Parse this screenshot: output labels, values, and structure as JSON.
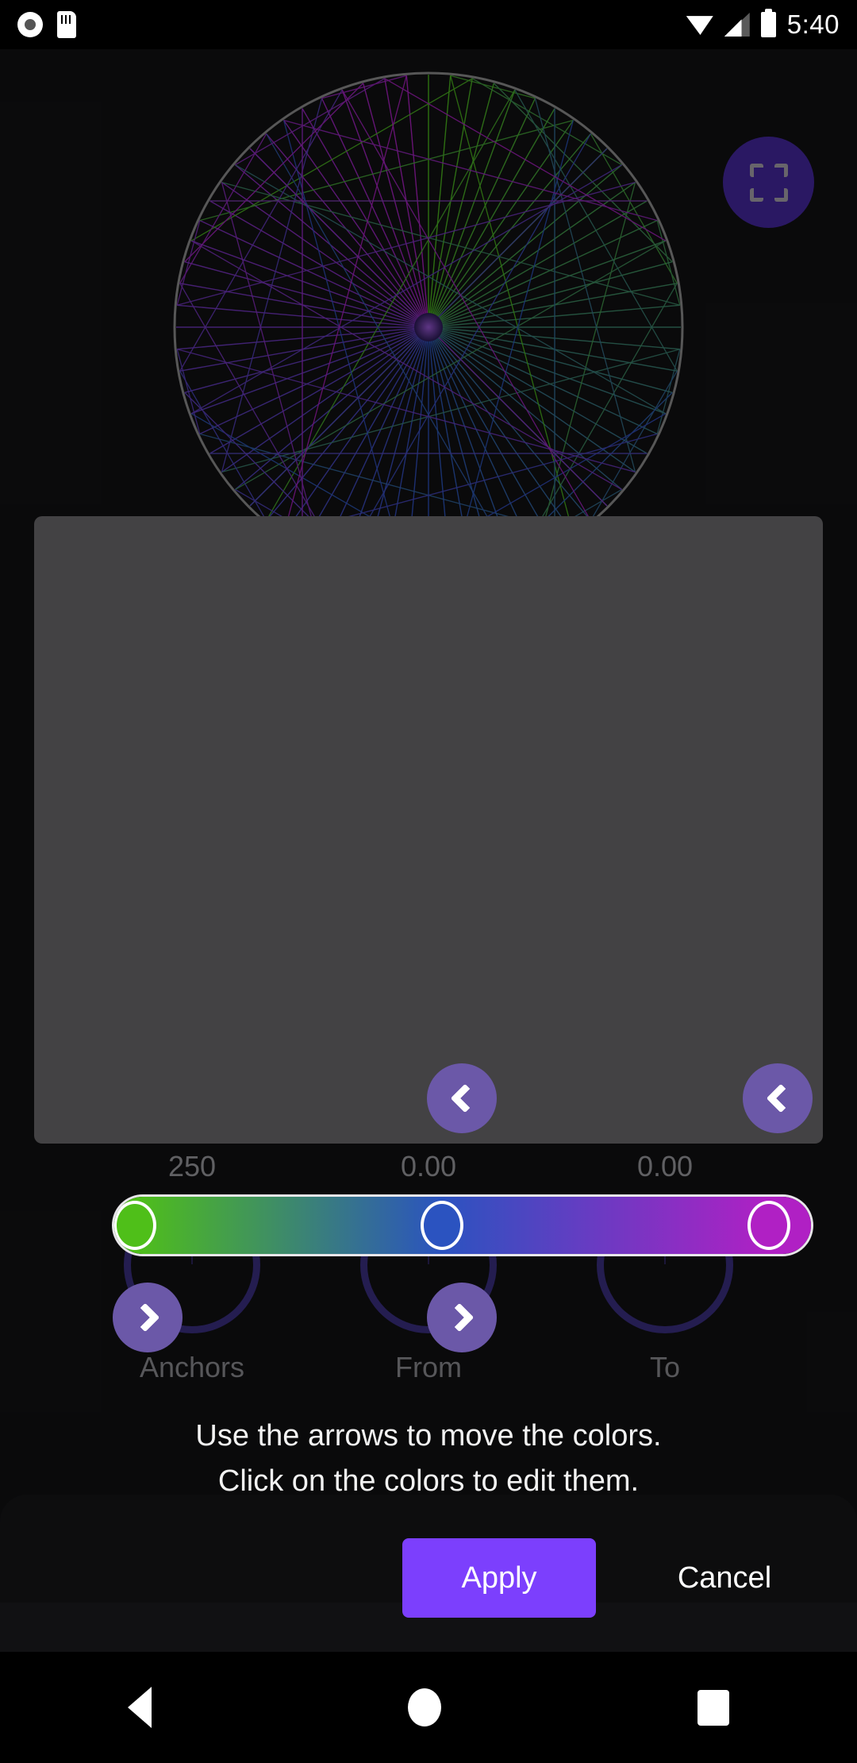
{
  "status_bar": {
    "time": "5:40",
    "icons": [
      "record-icon",
      "sd-card-icon",
      "wifi-icon",
      "cell-signal-icon",
      "battery-icon"
    ]
  },
  "canvas": {
    "fullscreen_button_icon": "fullscreen-icon",
    "accent_purple": "#4527a0",
    "background": "#111113"
  },
  "knobs": [
    {
      "value": "250",
      "label": "Anchors"
    },
    {
      "value": "0.00",
      "label": "From"
    },
    {
      "value": "0.00",
      "label": "To"
    }
  ],
  "dialog": {
    "move_left_upper_label": "‹",
    "move_left_lower_label": "‹",
    "move_right_first_label": "›",
    "move_right_second_label": "›",
    "hint_line_1": "Use the arrows to move the colors.",
    "hint_line_2": "Click on the colors to edit them.",
    "apply_label": "Apply",
    "cancel_label": "Cancel",
    "apply_color": "#7c3ffd",
    "surface_color": "#434244",
    "button_circle_color": "#6b58a8",
    "gradient_stops": [
      {
        "name": "green",
        "color": "#4fbf19",
        "position_pct": 3
      },
      {
        "name": "blue",
        "color": "#2b53c0",
        "position_pct": 47
      },
      {
        "name": "magenta",
        "color": "#b020c4",
        "position_pct": 94
      }
    ]
  },
  "bottom_strip": {
    "stops": [
      "#4fbf19",
      "#2b53c0",
      "#b020c4"
    ],
    "marker_positions_pct": [
      2,
      48,
      95
    ],
    "marker_color": "#b4b2b4"
  },
  "nav_bar": {
    "back_label": "back-icon",
    "home_label": "home-icon",
    "recents_label": "recents-icon"
  }
}
